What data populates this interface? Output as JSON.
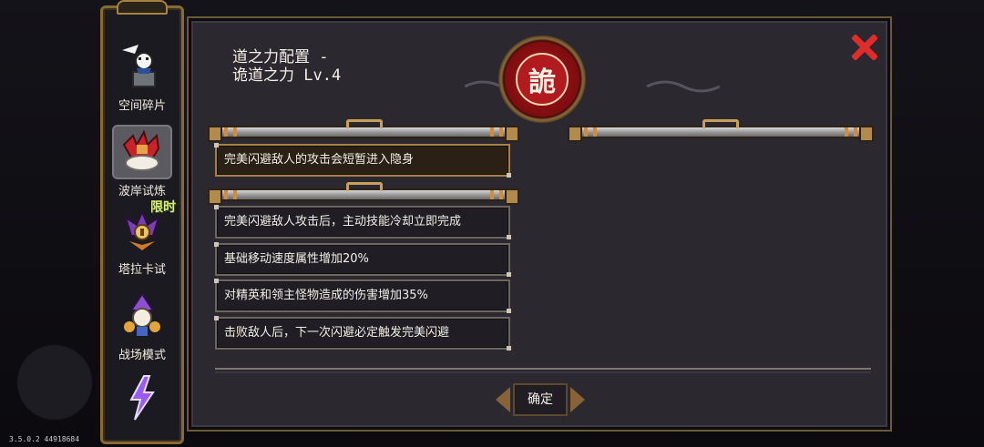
{
  "version": "3.5.0.2 44918684",
  "sidebar": {
    "items": [
      {
        "label": "空间碎片",
        "icon": "space-fragment-icon"
      },
      {
        "label": "波岸试炼",
        "icon": "shore-trial-icon"
      },
      {
        "label": "塔拉卡试",
        "icon": "taraka-trial-icon",
        "tag": "限时"
      },
      {
        "label": "战场模式",
        "icon": "battlefield-mode-icon"
      },
      {
        "label": "",
        "icon": "lightning-icon"
      }
    ]
  },
  "panel": {
    "title_line1": "道之力配置 -",
    "title_line2": "诡道之力 Lv.4",
    "emblem_char": "詭",
    "effects_top": [
      "完美闪避敌人的攻击会短暂进入隐身"
    ],
    "effects": [
      "完美闪避敌人攻击后，主动技能冷却立即完成",
      "基础移动速度属性增加20%",
      "对精英和领主怪物造成的伤害增加35%",
      "击败敌人后，下一次闪避必定触发完美闪避"
    ],
    "confirm_label": "确定"
  },
  "colors": {
    "accent_gold": "#a8803f",
    "emblem_red": "#b11a1f",
    "close_red": "#e12c2c"
  }
}
